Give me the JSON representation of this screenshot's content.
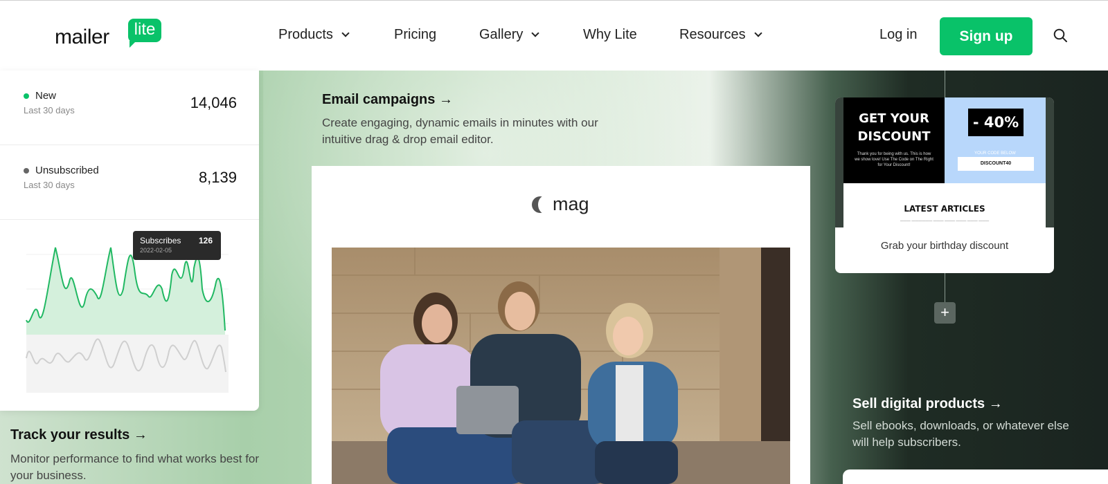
{
  "header": {
    "logo_word": "mailer",
    "logo_badge": "lite",
    "nav": [
      {
        "label": "Products",
        "dropdown": true
      },
      {
        "label": "Pricing",
        "dropdown": false
      },
      {
        "label": "Gallery",
        "dropdown": true
      },
      {
        "label": "Why Lite",
        "dropdown": false
      },
      {
        "label": "Resources",
        "dropdown": true
      }
    ],
    "login": "Log in",
    "signup": "Sign up",
    "search_icon": "search-icon"
  },
  "stats": {
    "rows": [
      {
        "label": "New",
        "sub": "Last 30 days",
        "value": "14,046",
        "dot_color": "#09c269"
      },
      {
        "label": "Unsubscribed",
        "sub": "Last 30 days",
        "value": "8,139",
        "dot_color": "#666666"
      }
    ],
    "tooltip": {
      "label": "Subscribes",
      "value": "126",
      "date": "2022-02-05"
    }
  },
  "track": {
    "title": "Track your results →",
    "desc": "Monitor performance to find what works best for your business."
  },
  "email": {
    "title": "Email campaigns →",
    "desc": "Create engaging, dynamic emails in minutes with our intuitive drag & drop email editor.",
    "brand": "mag"
  },
  "birthday": {
    "headline": "GET YOUR DISCOUNT",
    "discount": "- 40%",
    "code_label": "YOUR CODE BELOW",
    "code": "DISCOUNT40",
    "latest": "LATEST ARTICLES",
    "caption": "Grab your birthday discount",
    "small_text": "Thank you for being with us. This is how we show love! Use The Code on The Right for Your Discount!"
  },
  "sell": {
    "title": "Sell digital products →",
    "desc": "Sell ebooks, downloads, or whatever else will help subscribers."
  },
  "colors": {
    "brand_green": "#09c269",
    "dark_bg": "#1a2420"
  }
}
